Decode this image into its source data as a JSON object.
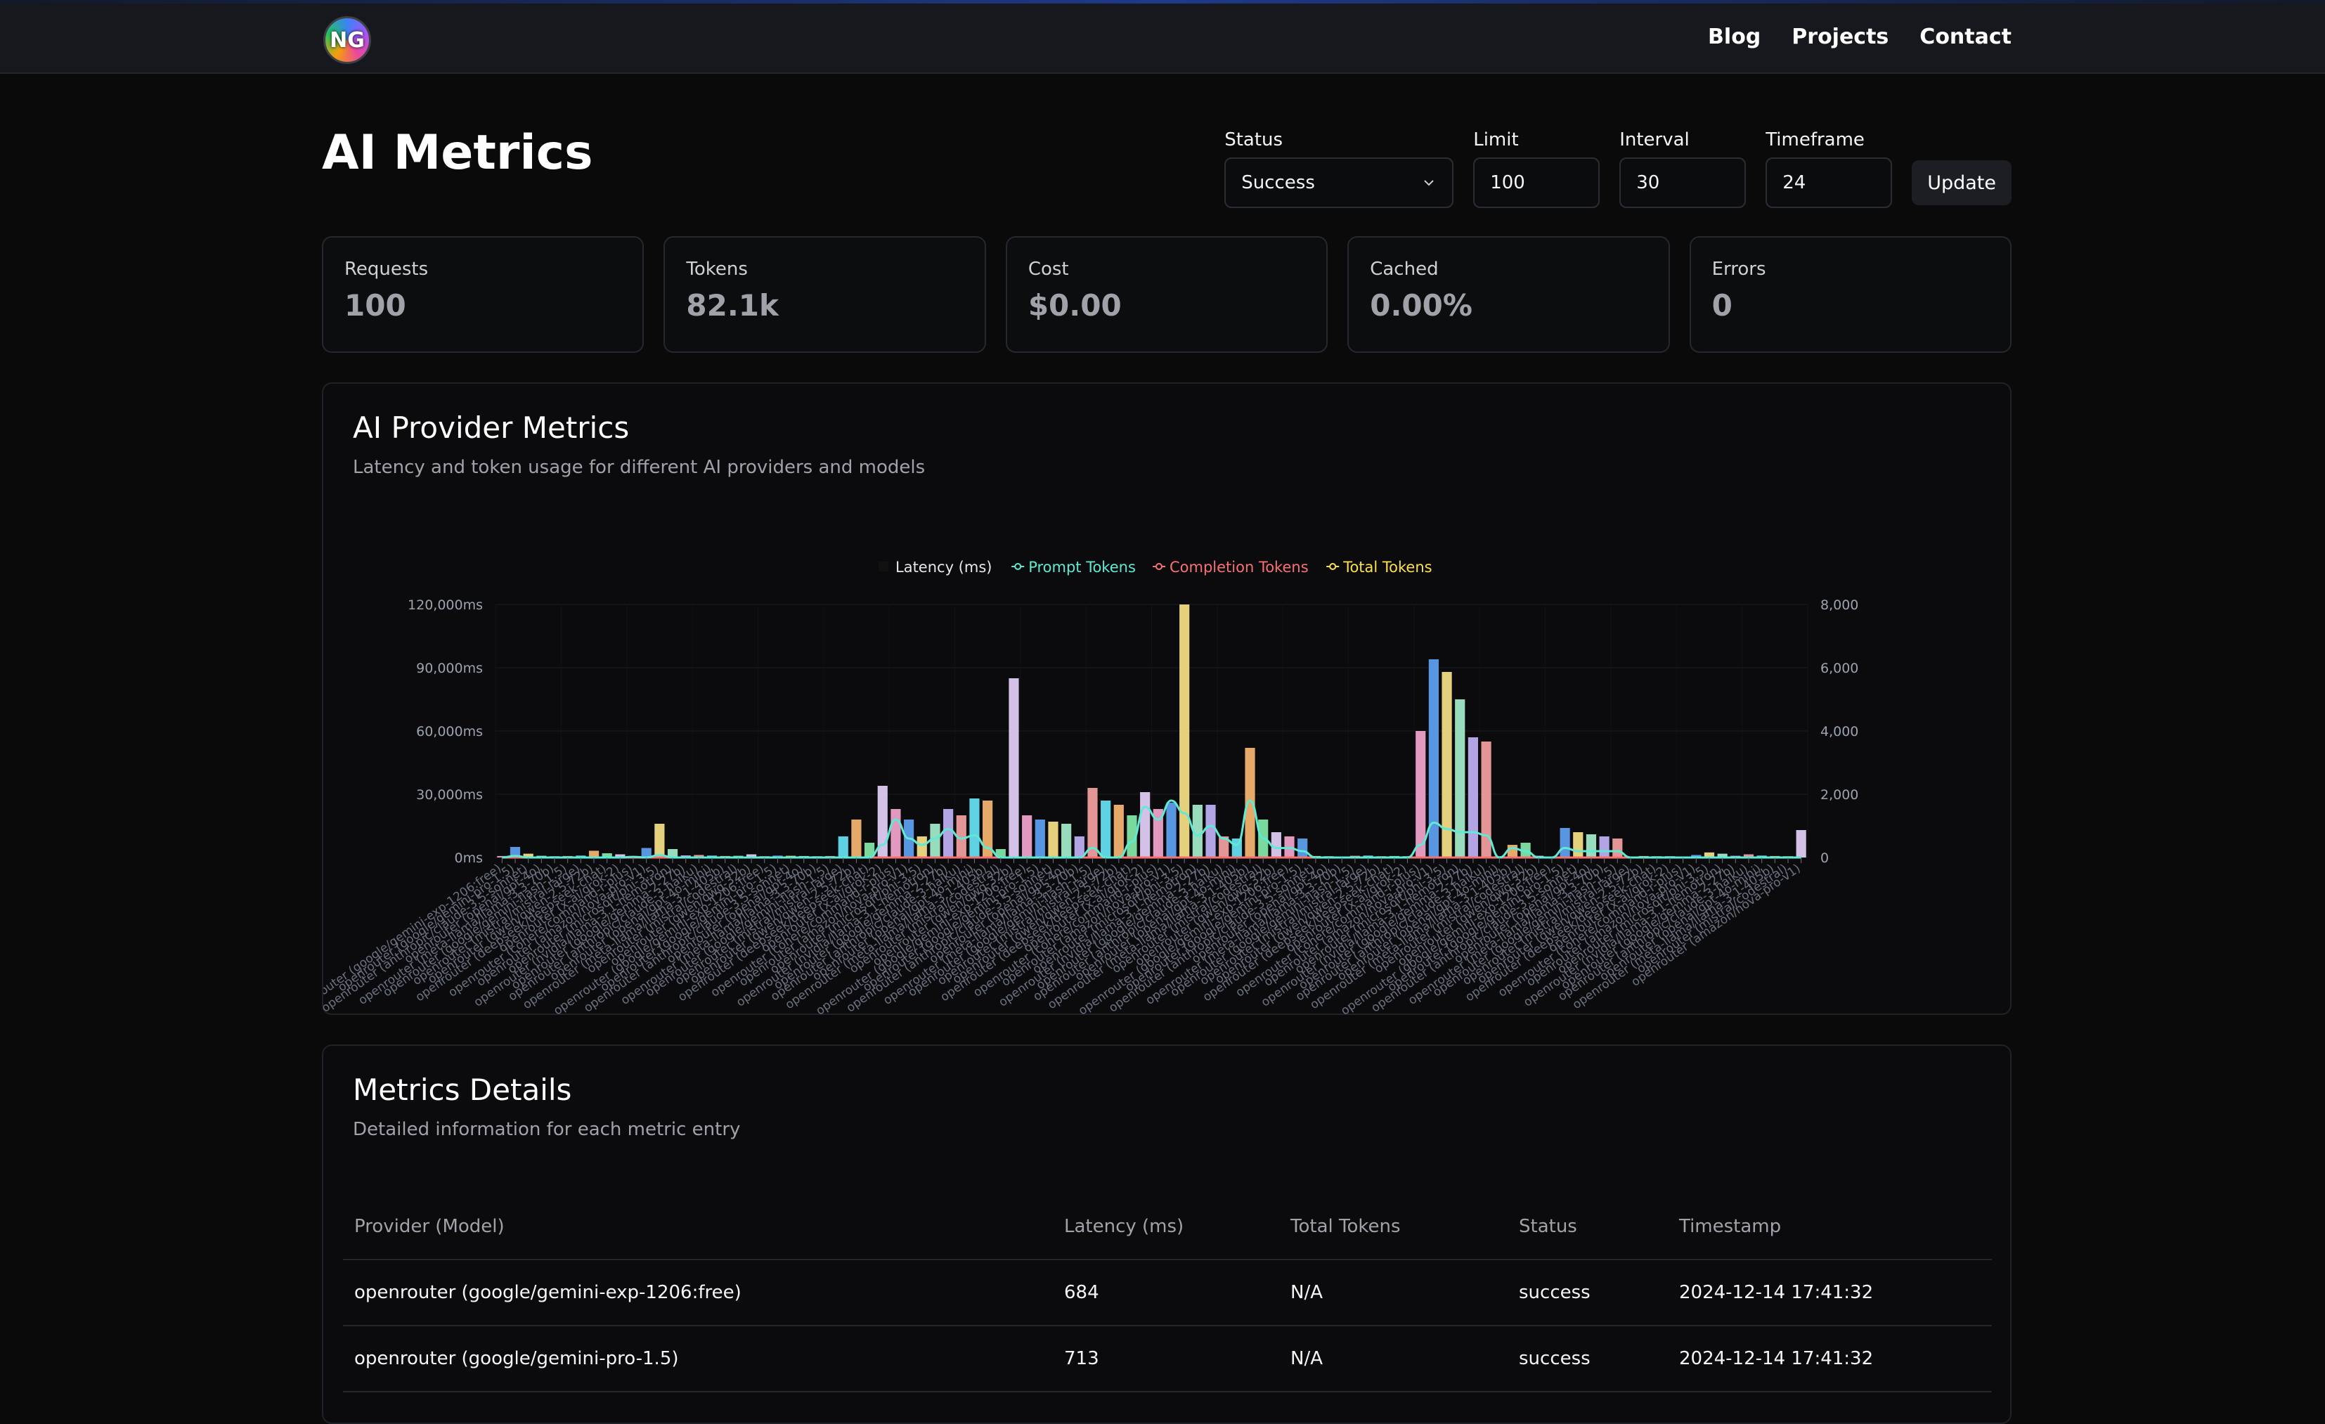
{
  "nav": {
    "logo_text": "NG",
    "links": [
      "Blog",
      "Projects",
      "Contact"
    ]
  },
  "page": {
    "title": "AI Metrics"
  },
  "filters": {
    "status": {
      "label": "Status",
      "value": "Success"
    },
    "limit": {
      "label": "Limit",
      "value": "100"
    },
    "interval": {
      "label": "Interval",
      "value": "30"
    },
    "timeframe": {
      "label": "Timeframe",
      "value": "24"
    },
    "update_label": "Update"
  },
  "stats": [
    {
      "label": "Requests",
      "value": "100"
    },
    {
      "label": "Tokens",
      "value": "82.1k"
    },
    {
      "label": "Cost",
      "value": "$0.00"
    },
    {
      "label": "Cached",
      "value": "0.00%"
    },
    {
      "label": "Errors",
      "value": "0"
    }
  ],
  "chart_card": {
    "title": "AI Provider Metrics",
    "subtitle": "Latency and token usage for different AI providers and models"
  },
  "chart_data": {
    "type": "bar",
    "title": "",
    "legend_position": "top",
    "series": [
      {
        "name": "Latency (ms)",
        "type": "bar",
        "axis": "left",
        "unit": "ms"
      },
      {
        "name": "Prompt Tokens",
        "type": "line",
        "axis": "right",
        "color": "#5eead4"
      },
      {
        "name": "Completion Tokens",
        "type": "line",
        "axis": "right",
        "color": "#f87171"
      },
      {
        "name": "Total Tokens",
        "type": "line",
        "axis": "right",
        "color": "#fde047"
      }
    ],
    "ylim_left": [
      0,
      120000
    ],
    "ylim_right": [
      0,
      8000
    ],
    "yticks_left": [
      "0ms",
      "30,000ms",
      "60,000ms",
      "90,000ms",
      "120,000ms"
    ],
    "yticks_right": [
      "0",
      "2,000",
      "4,000",
      "6,000",
      "8,000"
    ],
    "categories": [
      "openrouter (google/gemini-exp-1206:free)",
      "openrouter (google/gemini-pro-1.5)",
      "openrouter (anthropic/claude-3.5-sonnet)",
      "openrouter (openai/gpt-4o)",
      "openrouter (meta-llama/llama-3.3-70b)",
      "openrouter (google/gemini-flash-1.5)",
      "openrouter (mistral/mistral-large)",
      "openrouter (qwen/qwen-2.5-72b)",
      "openrouter (deepseek/deepseek-chat)",
      "openrouter (x-ai/grok-2)",
      "openrouter (cohere/command-r-plus)",
      "openrouter (amazon/nova-pro-v1)",
      "openrouter (microsoft/phi-3.5)",
      "openrouter (nvidia/llama-3.1-nemotron)",
      "openrouter (google/gemma-2-27b)",
      "openrouter (anthropic/claude-3-haiku)",
      "openrouter (openai/gpt-4o-mini)",
      "openrouter (meta-llama/llama-3.1-405b)",
      "openrouter (mistral/codestral)",
      "openrouter (qwen/qwq-32b)",
      "openrouter (google/gemini-exp-1206:free)",
      "openrouter (google/gemini-pro-1.5)",
      "openrouter (anthropic/claude-3.5-sonnet)",
      "openrouter (openai/gpt-4o)",
      "openrouter (meta-llama/llama-3.3-70b)",
      "openrouter (google/gemini-flash-1.5)",
      "openrouter (mistral/mistral-large)",
      "openrouter (qwen/qwen-2.5-72b)",
      "openrouter (deepseek/deepseek-chat)",
      "openrouter (x-ai/grok-2)",
      "openrouter (cohere/command-r-plus)",
      "openrouter (amazon/nova-pro-v1)",
      "openrouter (microsoft/phi-3.5)",
      "openrouter (nvidia/llama-3.1-nemotron)",
      "openrouter (google/gemma-2-27b)",
      "openrouter (anthropic/claude-3-haiku)",
      "openrouter (openai/gpt-4o-mini)",
      "openrouter (meta-llama/llama-3.1-405b)",
      "openrouter (mistral/codestral)",
      "openrouter (qwen/qwq-32b)",
      "openrouter (google/gemini-exp-1206:free)",
      "openrouter (google/gemini-pro-1.5)",
      "openrouter (anthropic/claude-3.5-sonnet)",
      "openrouter (openai/gpt-4o)",
      "openrouter (meta-llama/llama-3.3-70b)",
      "openrouter (google/gemini-flash-1.5)",
      "openrouter (mistral/mistral-large)",
      "openrouter (qwen/qwen-2.5-72b)",
      "openrouter (deepseek/deepseek-chat)",
      "openrouter (x-ai/grok-2)",
      "openrouter (cohere/command-r-plus)",
      "openrouter (amazon/nova-pro-v1)",
      "openrouter (microsoft/phi-3.5)",
      "openrouter (nvidia/llama-3.1-nemotron)",
      "openrouter (google/gemma-2-27b)",
      "openrouter (anthropic/claude-3-haiku)",
      "openrouter (openai/gpt-4o-mini)",
      "openrouter (meta-llama/llama-3.1-405b)",
      "openrouter (mistral/codestral)",
      "openrouter (qwen/qwq-32b)",
      "openrouter (google/gemini-exp-1206:free)",
      "openrouter (google/gemini-pro-1.5)",
      "openrouter (anthropic/claude-3.5-sonnet)",
      "openrouter (openai/gpt-4o)",
      "openrouter (meta-llama/llama-3.3-70b)",
      "openrouter (google/gemini-flash-1.5)",
      "openrouter (mistral/mistral-large)",
      "openrouter (qwen/qwen-2.5-72b)",
      "openrouter (deepseek/deepseek-chat)",
      "openrouter (x-ai/grok-2)",
      "openrouter (cohere/command-r-plus)",
      "openrouter (amazon/nova-pro-v1)",
      "openrouter (microsoft/phi-3.5)",
      "openrouter (nvidia/llama-3.1-nemotron)",
      "openrouter (google/gemma-2-27b)",
      "openrouter (anthropic/claude-3-haiku)",
      "openrouter (openai/gpt-4o-mini)",
      "openrouter (meta-llama/llama-3.1-405b)",
      "openrouter (mistral/codestral)",
      "openrouter (qwen/qwq-32b)",
      "openrouter (google/gemini-exp-1206:free)",
      "openrouter (google/gemini-pro-1.5)",
      "openrouter (anthropic/claude-3.5-sonnet)",
      "openrouter (openai/gpt-4o)",
      "openrouter (meta-llama/llama-3.3-70b)",
      "openrouter (google/gemini-flash-1.5)",
      "openrouter (mistral/mistral-large)",
      "openrouter (qwen/qwen-2.5-72b)",
      "openrouter (deepseek/deepseek-chat)",
      "openrouter (x-ai/grok-2)",
      "openrouter (cohere/command-r-plus)",
      "openrouter (amazon/nova-pro-v1)",
      "openrouter (microsoft/phi-3.5)",
      "openrouter (nvidia/llama-3.1-nemotron)",
      "openrouter (google/gemma-2-27b)",
      "openrouter (anthropic/claude-3-haiku)",
      "openrouter (openai/gpt-4o-mini)",
      "openrouter (meta-llama/llama-3.1-405b)",
      "openrouter (mistral/codestral)",
      "openrouter (amazon/nova-pro-v1)"
    ],
    "latency": [
      700,
      5000,
      1800,
      800,
      600,
      700,
      900,
      3200,
      2000,
      1500,
      700,
      4500,
      16000,
      4000,
      1000,
      1200,
      900,
      700,
      800,
      1500,
      600,
      900,
      800,
      700,
      600,
      700,
      10000,
      18000,
      7000,
      34000,
      23000,
      18000,
      10000,
      16000,
      23000,
      20000,
      28000,
      27000,
      4000,
      85000,
      20000,
      18000,
      17000,
      16000,
      10000,
      33000,
      27000,
      25000,
      20000,
      31000,
      23000,
      26000,
      120000,
      25000,
      25000,
      10000,
      9000,
      52000,
      18000,
      12000,
      10000,
      9000,
      700,
      600,
      500,
      800,
      900,
      600,
      700,
      600,
      60000,
      94000,
      88000,
      75000,
      57000,
      55000,
      600,
      6000,
      7000,
      800,
      500,
      14000,
      12000,
      11000,
      10000,
      9000,
      500,
      700,
      600,
      600,
      500,
      1200,
      2400,
      1800,
      800,
      1500,
      900,
      700,
      600,
      13000
    ],
    "bar_colors": [
      "#f9a8d4",
      "#60a5fa",
      "#fde68a",
      "#a7f3d0",
      "#c4b5fd",
      "#fca5a5",
      "#67e8f9",
      "#fdba74",
      "#86efac",
      "#e9d5ff"
    ],
    "prompt_tokens": [
      0,
      50,
      0,
      0,
      0,
      0,
      0,
      0,
      0,
      0,
      20,
      0,
      80,
      0,
      0,
      0,
      0,
      0,
      0,
      0,
      0,
      0,
      0,
      0,
      0,
      0,
      0,
      0,
      0,
      400,
      1200,
      600,
      400,
      600,
      900,
      600,
      700,
      300,
      0,
      0,
      0,
      0,
      0,
      0,
      0,
      300,
      0,
      0,
      500,
      1600,
      1200,
      1800,
      1400,
      700,
      1000,
      600,
      400,
      1800,
      600,
      300,
      300,
      200,
      0,
      0,
      0,
      0,
      0,
      0,
      0,
      0,
      400,
      1100,
      900,
      800,
      800,
      700,
      0,
      300,
      200,
      0,
      0,
      300,
      200,
      200,
      200,
      200,
      0,
      0,
      0,
      0,
      0,
      0,
      0,
      0,
      0,
      0,
      0,
      0,
      0,
      0
    ],
    "completion_tokens": [
      0,
      0,
      0,
      0,
      0,
      0,
      0,
      0,
      0,
      0,
      0,
      0,
      0,
      0,
      0,
      0,
      0,
      0,
      0,
      0,
      0,
      0,
      0,
      0,
      0,
      0,
      0,
      0,
      0,
      0,
      0,
      0,
      0,
      0,
      0,
      0,
      0,
      0,
      0,
      0,
      0,
      0,
      0,
      0,
      0,
      0,
      0,
      0,
      0,
      0,
      0,
      0,
      0,
      0,
      0,
      0,
      0,
      0,
      0,
      0,
      0,
      0,
      0,
      0,
      0,
      0,
      0,
      0,
      0,
      0,
      0,
      0,
      0,
      0,
      0,
      0,
      0,
      0,
      0,
      0,
      0,
      0,
      0,
      0,
      0,
      0,
      0,
      0,
      0,
      0,
      0,
      0,
      0,
      0,
      0,
      0,
      0,
      0,
      0,
      0
    ],
    "total_tokens": [
      0,
      0,
      0,
      0,
      0,
      0,
      0,
      0,
      0,
      0,
      0,
      0,
      0,
      0,
      0,
      0,
      0,
      0,
      0,
      0,
      0,
      0,
      0,
      0,
      0,
      0,
      0,
      0,
      0,
      0,
      0,
      0,
      0,
      0,
      0,
      0,
      0,
      0,
      0,
      0,
      0,
      0,
      0,
      0,
      0,
      0,
      0,
      0,
      0,
      0,
      0,
      0,
      0,
      0,
      0,
      0,
      0,
      0,
      0,
      0,
      0,
      0,
      0,
      0,
      0,
      0,
      0,
      0,
      0,
      0,
      0,
      0,
      0,
      0,
      0,
      0,
      0,
      0,
      0,
      0,
      0,
      0,
      0,
      0,
      0,
      0,
      0,
      0,
      0,
      0,
      0,
      0,
      0,
      0,
      0,
      0,
      0,
      0,
      0,
      0
    ]
  },
  "details": {
    "title": "Metrics Details",
    "subtitle": "Detailed information for each metric entry",
    "columns": [
      "Provider (Model)",
      "Latency (ms)",
      "Total Tokens",
      "Status",
      "Timestamp"
    ],
    "rows": [
      [
        "openrouter (google/gemini-exp-1206:free)",
        "684",
        "N/A",
        "success",
        "2024-12-14 17:41:32"
      ],
      [
        "openrouter (google/gemini-pro-1.5)",
        "713",
        "N/A",
        "success",
        "2024-12-14 17:41:32"
      ]
    ]
  }
}
